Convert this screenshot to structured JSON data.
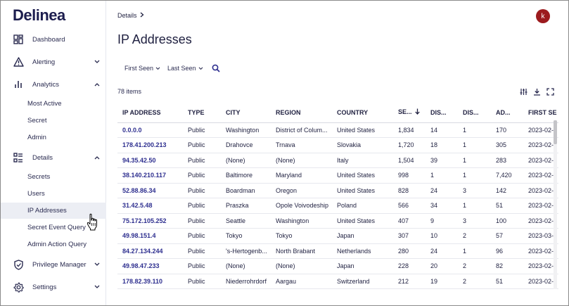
{
  "brand": "Delinea",
  "sidebar": {
    "items": [
      {
        "label": "Dashboard",
        "icon": "dashboard-icon"
      },
      {
        "label": "Alerting",
        "icon": "warning-icon"
      },
      {
        "label": "Analytics",
        "icon": "bar-chart-icon"
      },
      {
        "label": "Details",
        "icon": "list-icon"
      },
      {
        "label": "Privilege Manager",
        "icon": "shield-icon"
      },
      {
        "label": "Settings",
        "icon": "gear-icon"
      }
    ],
    "analytics_sub": [
      "Most Active",
      "Secret",
      "Admin"
    ],
    "details_sub": [
      "Secrets",
      "Users",
      "IP Addresses",
      "Secret Event Query",
      "Admin Action Query"
    ]
  },
  "header": {
    "breadcrumb": "Details",
    "avatar_initial": "k",
    "title": "IP Addresses"
  },
  "filters": {
    "first_seen": "First Seen",
    "last_seen": "Last Seen"
  },
  "count_label": "78 items",
  "table": {
    "columns": [
      "IP ADDRESS",
      "TYPE",
      "CITY",
      "REGION",
      "COUNTRY",
      "SE...",
      "DIS...",
      "DIS...",
      "AD...",
      "FIRST SE"
    ],
    "rows": [
      [
        "0.0.0.0",
        "Public",
        "Washington",
        "District of Colum...",
        "United States",
        "1,834",
        "14",
        "1",
        "170",
        "2023-02-"
      ],
      [
        "178.41.200.213",
        "Public",
        "Drahovce",
        "Trnava",
        "Slovakia",
        "1,720",
        "18",
        "1",
        "305",
        "2023-02-"
      ],
      [
        "94.35.42.50",
        "Public",
        "(None)",
        "(None)",
        "Italy",
        "1,504",
        "39",
        "1",
        "283",
        "2023-02-"
      ],
      [
        "38.140.210.117",
        "Public",
        "Baltimore",
        "Maryland",
        "United States",
        "998",
        "1",
        "1",
        "7,420",
        "2023-02-"
      ],
      [
        "52.88.86.34",
        "Public",
        "Boardman",
        "Oregon",
        "United States",
        "828",
        "24",
        "3",
        "142",
        "2023-02-"
      ],
      [
        "31.42.5.48",
        "Public",
        "Praszka",
        "Opole Voivodeship",
        "Poland",
        "566",
        "34",
        "1",
        "51",
        "2023-02-"
      ],
      [
        "75.172.105.252",
        "Public",
        "Seattle",
        "Washington",
        "United States",
        "407",
        "9",
        "3",
        "100",
        "2023-02-"
      ],
      [
        "49.98.151.4",
        "Public",
        "Tokyo",
        "Tokyo",
        "Japan",
        "307",
        "10",
        "2",
        "57",
        "2023-03-"
      ],
      [
        "84.27.134.244",
        "Public",
        "'s-Hertogenb...",
        "North Brabant",
        "Netherlands",
        "280",
        "24",
        "1",
        "96",
        "2023-02-"
      ],
      [
        "49.98.47.233",
        "Public",
        "(None)",
        "(None)",
        "Japan",
        "228",
        "20",
        "2",
        "82",
        "2023-02-"
      ],
      [
        "178.82.39.110",
        "Public",
        "Niederrohrdorf",
        "Aargau",
        "Switzerland",
        "212",
        "19",
        "2",
        "51",
        "2023-02-"
      ]
    ]
  },
  "colors": {
    "brand": "#1c1d4e",
    "link": "#2e2f8f",
    "avatar": "#9c1b1e",
    "active_bg": "#eceef4"
  }
}
